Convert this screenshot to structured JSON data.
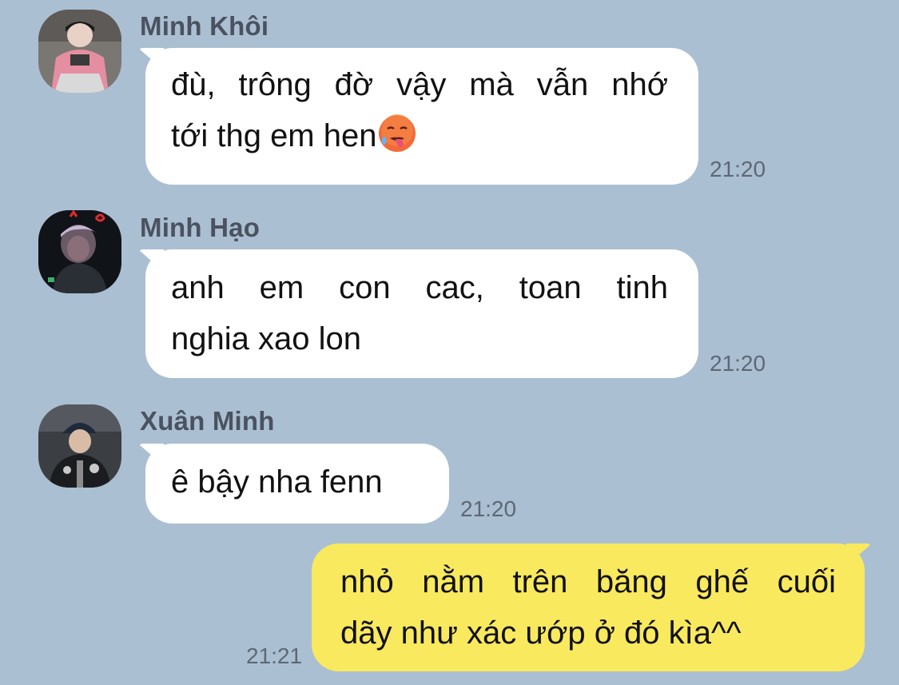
{
  "messages": [
    {
      "sender": "Minh Khôi",
      "avatar": "avatar-minh-khoi",
      "line1_words": [
        "đù,",
        "trông",
        "đờ",
        "vậy",
        "mà",
        "vẫn",
        "nhớ"
      ],
      "line2": "tới thg em hen",
      "emoji": "hot-face-emoji",
      "time": "21:20"
    },
    {
      "sender": "Minh Hạo",
      "avatar": "avatar-minh-hao",
      "line1_words": [
        "anh",
        "em",
        "con",
        "cac,",
        "toan",
        "tinh"
      ],
      "line2": "nghia xao lon",
      "time": "21:20"
    },
    {
      "sender": "Xuân Minh",
      "avatar": "avatar-xuan-minh",
      "line1": "ê bậy nha fenn",
      "time": "21:20"
    },
    {
      "sender": "me",
      "line1_words": [
        "nhỏ",
        "nằm",
        "trên",
        "băng",
        "ghế",
        "cuối"
      ],
      "line2": "dãy như xác ướp ở đó kìa^^",
      "time": "21:21"
    }
  ],
  "colors": {
    "background": "#abbfd2",
    "incoming_bubble": "#ffffff",
    "outgoing_bubble": "#f9e95e",
    "sender_name": "#4a5260",
    "timestamp": "#5d6876"
  }
}
